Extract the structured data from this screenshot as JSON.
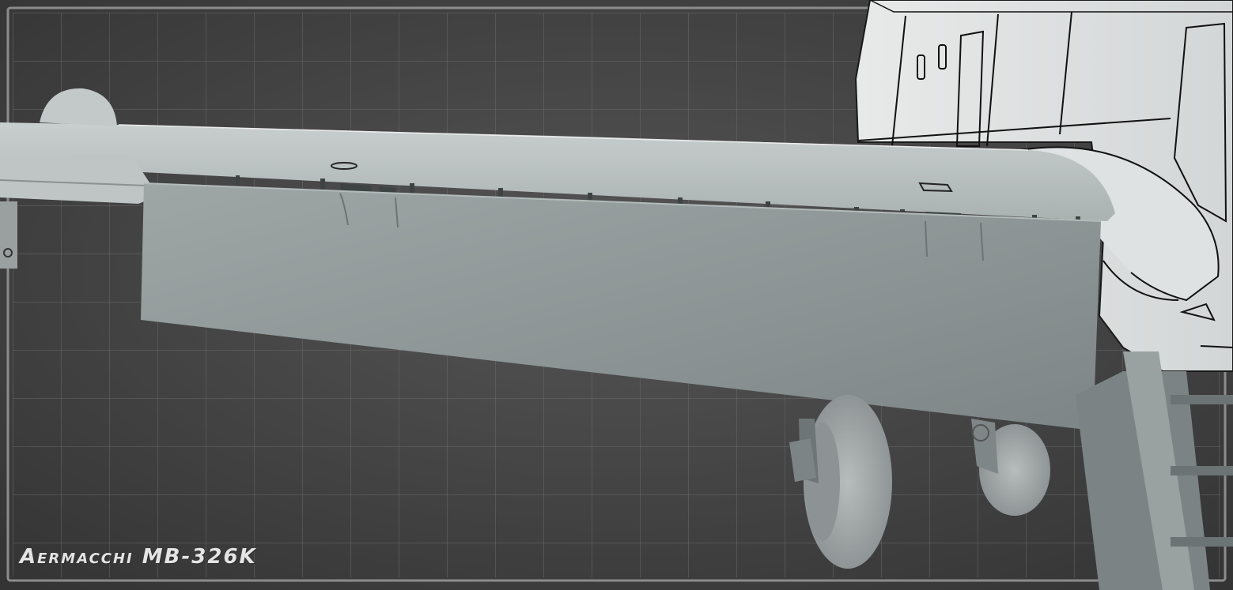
{
  "caption": {
    "title": "Aermacchi MB-326K"
  }
}
